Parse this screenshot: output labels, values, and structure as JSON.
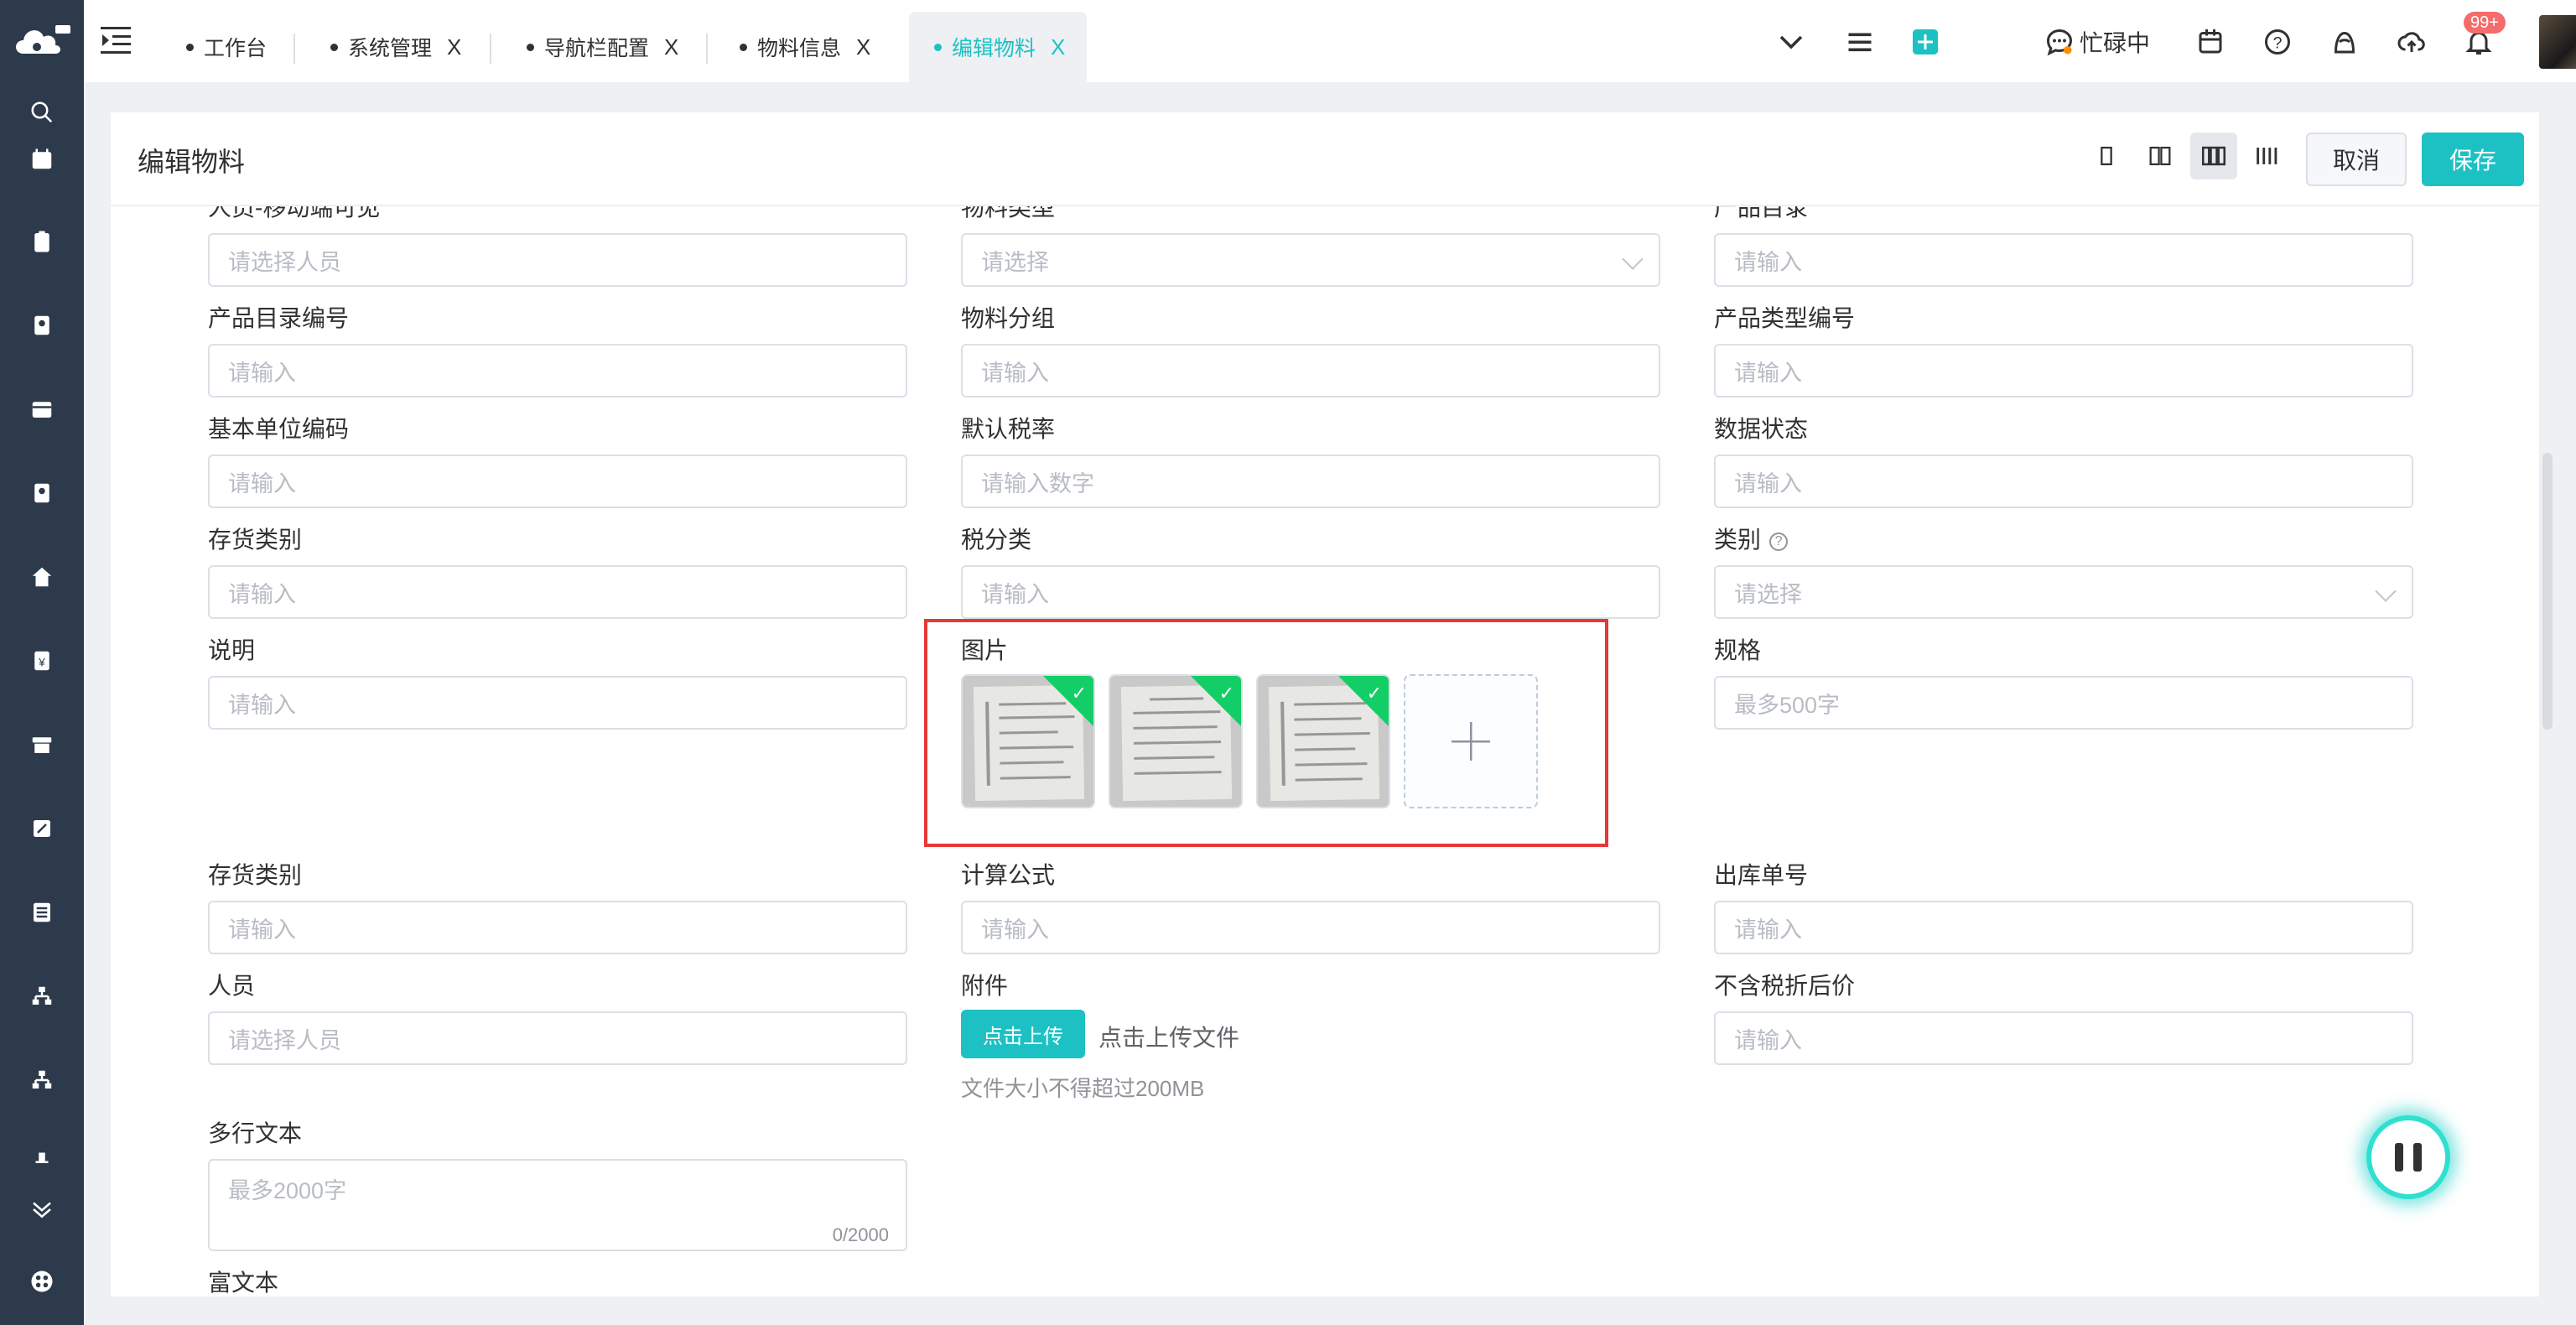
{
  "tabs": [
    {
      "label": "工作台",
      "close": ""
    },
    {
      "label": "系统管理",
      "close": "X"
    },
    {
      "label": "导航栏配置",
      "close": "X"
    },
    {
      "label": "物料信息",
      "close": "X"
    },
    {
      "label": "编辑物料",
      "close": "X"
    }
  ],
  "header": {
    "status_label": "忙碌中",
    "badge": "99+"
  },
  "page": {
    "title": "编辑物料",
    "cancel": "取消",
    "save": "保存"
  },
  "fields": {
    "r0": [
      {
        "label": "人员-移动端可见",
        "placeholder": "请选择人员"
      },
      {
        "label": "物料类型",
        "placeholder": "请选择"
      },
      {
        "label": "产品目录",
        "placeholder": "请输入"
      }
    ],
    "r1": [
      {
        "label": "产品目录编号",
        "placeholder": "请输入"
      },
      {
        "label": "物料分组",
        "placeholder": "请输入"
      },
      {
        "label": "产品类型编号",
        "placeholder": "请输入"
      }
    ],
    "r2": [
      {
        "label": "基本单位编码",
        "placeholder": "请输入"
      },
      {
        "label": "默认税率",
        "placeholder": "请输入数字"
      },
      {
        "label": "数据状态",
        "placeholder": "请输入"
      }
    ],
    "r3": [
      {
        "label": "存货类别",
        "placeholder": "请输入"
      },
      {
        "label": "税分类",
        "placeholder": "请输入"
      },
      {
        "label": "类别",
        "placeholder": "请选择",
        "help": "?"
      }
    ],
    "r4": [
      {
        "label": "说明",
        "placeholder": "请输入"
      },
      {
        "label": "图片"
      },
      {
        "label": "规格",
        "placeholder": "最多500字"
      }
    ],
    "r5": [
      {
        "label": "存货类别",
        "placeholder": "请输入"
      },
      {
        "label": "计算公式",
        "placeholder": "请输入"
      },
      {
        "label": "出库单号",
        "placeholder": "请输入"
      }
    ],
    "r6": [
      {
        "label": "人员",
        "placeholder": "请选择人员"
      },
      {
        "label": "附件"
      },
      {
        "label": "不含税折后价",
        "placeholder": "请输入"
      }
    ],
    "r7": [
      {
        "label": "多行文本",
        "placeholder": "最多2000字",
        "counter": "0/2000"
      }
    ],
    "r8": [
      {
        "label": "富文本"
      }
    ]
  },
  "attachment": {
    "button": "点击上传",
    "text": "点击上传文件",
    "tip": "文件大小不得超过200MB"
  },
  "images": {
    "count": 3,
    "upload_icon": "plus-icon"
  },
  "colors": {
    "accent": "#1ec1c3",
    "sidebar": "#2d3a4b",
    "success": "#13ce66",
    "highlight": "#e53935",
    "badge": "#f56c6c"
  }
}
